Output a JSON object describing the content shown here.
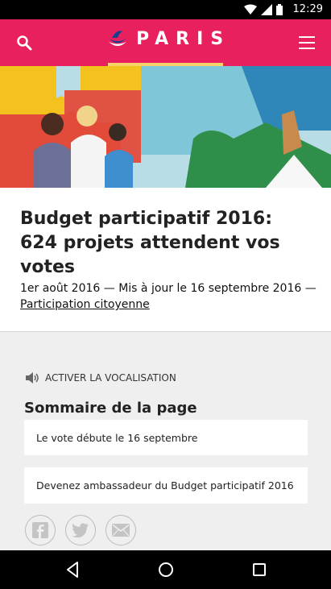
{
  "status_bar": {
    "time": "12:29"
  },
  "header": {
    "brand": "PARIS",
    "accent": "#e8205d",
    "underline_color": "#f6d26b"
  },
  "article": {
    "title": "Budget participatif 2016: 624 projets attendent vos votes",
    "date": "1er août 2016 — Mis à jour le 16 septembre 2016 —",
    "category_link": "Participation citoyenne"
  },
  "vocalisation": {
    "label": "ACTIVER LA VOCALISATION"
  },
  "summary": {
    "title": "Sommaire de la page",
    "items": [
      {
        "label": "Le vote débute le 16 septembre"
      },
      {
        "label": "Devenez ambassadeur du Budget participatif 2016"
      }
    ]
  },
  "share": {
    "icons": [
      "facebook-icon",
      "twitter-icon",
      "mail-icon"
    ]
  },
  "nav": {
    "icons": [
      "back-icon",
      "home-icon",
      "recent-apps-icon"
    ]
  }
}
